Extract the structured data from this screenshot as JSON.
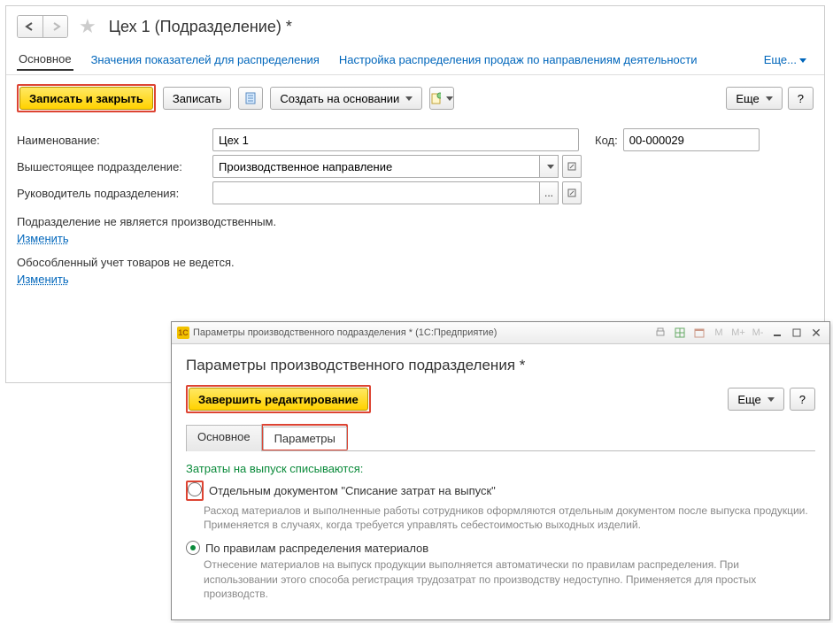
{
  "main": {
    "title": "Цех 1 (Подразделение) *",
    "nav_tabs": {
      "main": "Основное",
      "values": "Значения показателей для распределения",
      "sales": "Настройка распределения продаж по направлениям деятельности",
      "more": "Еще..."
    },
    "toolbar": {
      "write_close": "Записать и закрыть",
      "write": "Записать",
      "create_based": "Создать на основании",
      "more": "Еще",
      "help": "?"
    },
    "fields": {
      "name_label": "Наименование:",
      "name_value": "Цех 1",
      "code_label": "Код:",
      "code_value": "00-000029",
      "parent_label": "Вышестоящее подразделение:",
      "parent_value": "Производственное направление",
      "manager_label": "Руководитель подразделения:",
      "manager_value": ""
    },
    "info1": "Подразделение не является производственным.",
    "info2": "Обособленный учет товаров не ведется.",
    "change_link": "Изменить"
  },
  "sub": {
    "titlebar": "Параметры производственного подразделения * (1С:Предприятие)",
    "heading": "Параметры производственного подразделения *",
    "toolbar": {
      "finish": "Завершить редактирование",
      "more": "Еще",
      "help": "?"
    },
    "tabs": {
      "main": "Основное",
      "params": "Параметры"
    },
    "section_title": "Затраты на выпуск списываются:",
    "opt1_label": "Отдельным документом \"Списание затрат на выпуск\"",
    "opt1_desc": "Расход материалов и выполненные работы сотрудников оформляются отдельным документом после выпуска продукции. Применяется в случаях, когда требуется управлять себестоимостью выходных изделий.",
    "opt2_label": "По правилам распределения материалов",
    "opt2_desc": "Отнесение материалов на выпуск продукции выполняется автоматически по правилам распределения. При использовании этого способа регистрация трудозатрат по производству недоступно. Применяется для простых производств."
  },
  "mm": {
    "m": "M",
    "mp": "M+",
    "mm": "M-"
  }
}
